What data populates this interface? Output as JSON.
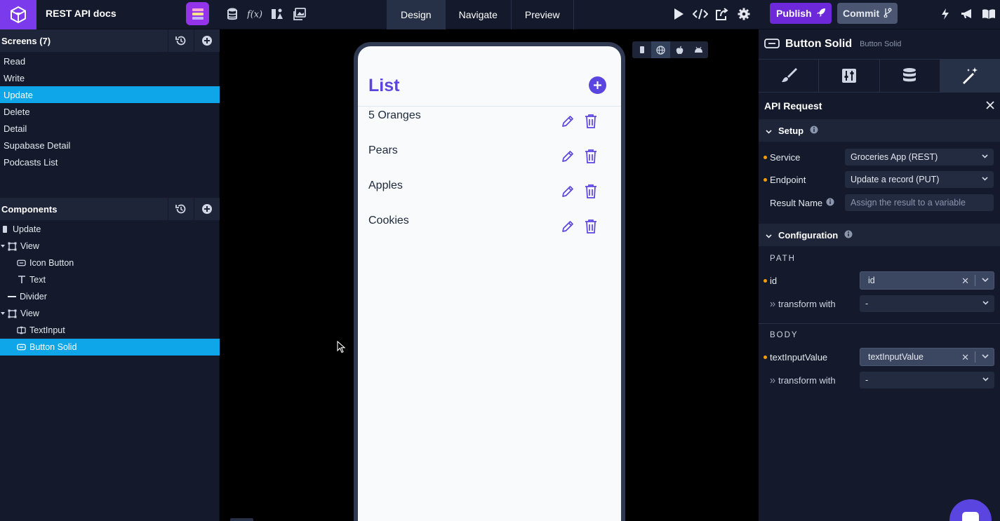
{
  "topbar": {
    "project_title": "REST API docs",
    "tabs": [
      {
        "label": "Design",
        "active": true
      },
      {
        "label": "Navigate",
        "active": false
      },
      {
        "label": "Preview",
        "active": false
      }
    ],
    "publish_label": "Publish",
    "commit_label": "Commit"
  },
  "screens": {
    "header": "Screens (7)",
    "items": [
      "Read",
      "Write",
      "Update",
      "Delete",
      "Detail",
      "Supabase Detail",
      "Podcasts List"
    ],
    "selected": "Update"
  },
  "components": {
    "header": "Components",
    "items": [
      {
        "label": "Update",
        "icon": "screen-icon"
      },
      {
        "label": "View",
        "icon": "view-icon"
      },
      {
        "label": "Icon Button",
        "icon": "button-icon"
      },
      {
        "label": "Text",
        "icon": "text-icon"
      },
      {
        "label": "Divider",
        "icon": "divider-icon"
      },
      {
        "label": "View",
        "icon": "view-icon"
      },
      {
        "label": "TextInput",
        "icon": "textinput-icon"
      },
      {
        "label": "Button Solid",
        "icon": "button-icon"
      }
    ],
    "selected": "Button Solid"
  },
  "phone": {
    "list_title": "List",
    "rows": [
      "5 Oranges",
      "Pears",
      "Apples",
      "Cookies"
    ]
  },
  "panel": {
    "component_name": "Button Solid",
    "component_type": "Button Solid",
    "api_title": "API Request",
    "setup": {
      "header": "Setup",
      "service_label": "Service",
      "service_value": "Groceries App (REST)",
      "endpoint_label": "Endpoint",
      "endpoint_value": "Update a record (PUT)",
      "result_label": "Result Name",
      "result_placeholder": "Assign the result to a variable"
    },
    "configuration": {
      "header": "Configuration",
      "path_label": "PATH",
      "id_label": "id",
      "id_value": "id",
      "transform_label": "transform with",
      "transform_value": "-",
      "body_label": "BODY",
      "text_input_label": "textInputValue",
      "text_input_value": "textInputValue",
      "transform2_label": "transform with",
      "transform2_value": "-"
    }
  },
  "colors": {
    "accent": "#5b45e0",
    "selected": "#0ea5e9",
    "publish": "#6d28d9",
    "background": "#141a2b"
  }
}
